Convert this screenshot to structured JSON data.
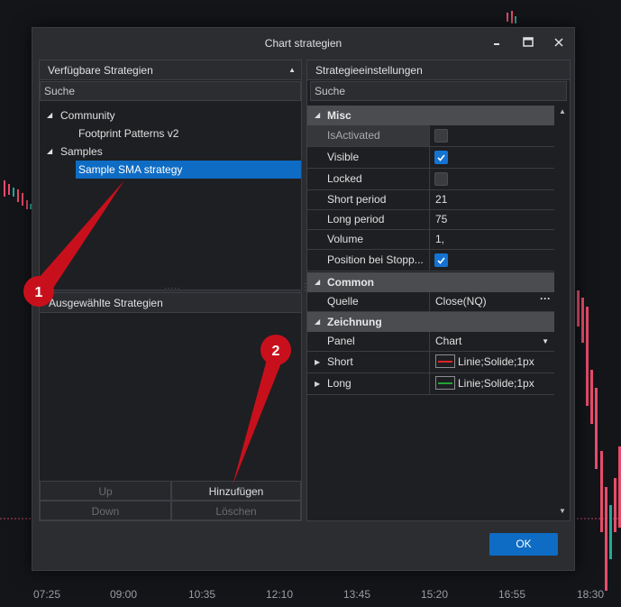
{
  "background": {
    "time_labels": [
      "07:25",
      "09:00",
      "10:35",
      "12:10",
      "13:45",
      "15:20",
      "16:55",
      "18:30"
    ]
  },
  "dialog": {
    "title": "Chart strategien",
    "minimize_icon": "minimize-icon",
    "maximize_icon": "maximize-icon",
    "close_icon": "close-icon"
  },
  "left": {
    "available_header": "Verfügbare Strategien",
    "search_placeholder": "Suche",
    "tree": [
      {
        "label": "Community",
        "level": 0,
        "expanded": true
      },
      {
        "label": "Footprint Patterns v2",
        "level": 1
      },
      {
        "label": "Samples",
        "level": 0,
        "expanded": true
      },
      {
        "label": "Sample SMA strategy",
        "level": 1,
        "selected": true
      }
    ],
    "selected_header": "Ausgewählte Strategien",
    "buttons": {
      "up": "Up",
      "add": "Hinzufügen",
      "down": "Down",
      "delete": "Löschen"
    }
  },
  "right": {
    "header": "Strategieeinstellungen",
    "search_placeholder": "Suche",
    "categories": {
      "misc": "Misc",
      "common": "Common",
      "drawing": "Zeichnung"
    },
    "props": {
      "isactivated": {
        "name": "IsActivated",
        "checked": false
      },
      "visible": {
        "name": "Visible",
        "checked": true
      },
      "locked": {
        "name": "Locked",
        "checked": false
      },
      "short_period": {
        "name": "Short period",
        "value": "21"
      },
      "long_period": {
        "name": "Long period",
        "value": "75"
      },
      "volume": {
        "name": "Volume",
        "value": "1,"
      },
      "position_stop": {
        "name": "Position bei Stopp...",
        "checked": true
      },
      "source": {
        "name": "Quelle",
        "value": "Close(NQ)"
      },
      "panel": {
        "name": "Panel",
        "value": "Chart"
      },
      "short": {
        "name": "Short",
        "value": "Linie;Solide;1px",
        "color": "#e02424"
      },
      "long": {
        "name": "Long",
        "value": "Linie;Solide;1px",
        "color": "#21a336"
      }
    }
  },
  "ok_label": "OK",
  "annotations": {
    "marker1": "1",
    "marker2": "2"
  },
  "colors": {
    "accent": "#0e6cc4",
    "annotation_red": "#c8101c",
    "candle_up": "#26a69a",
    "candle_down": "#e84c6a"
  }
}
